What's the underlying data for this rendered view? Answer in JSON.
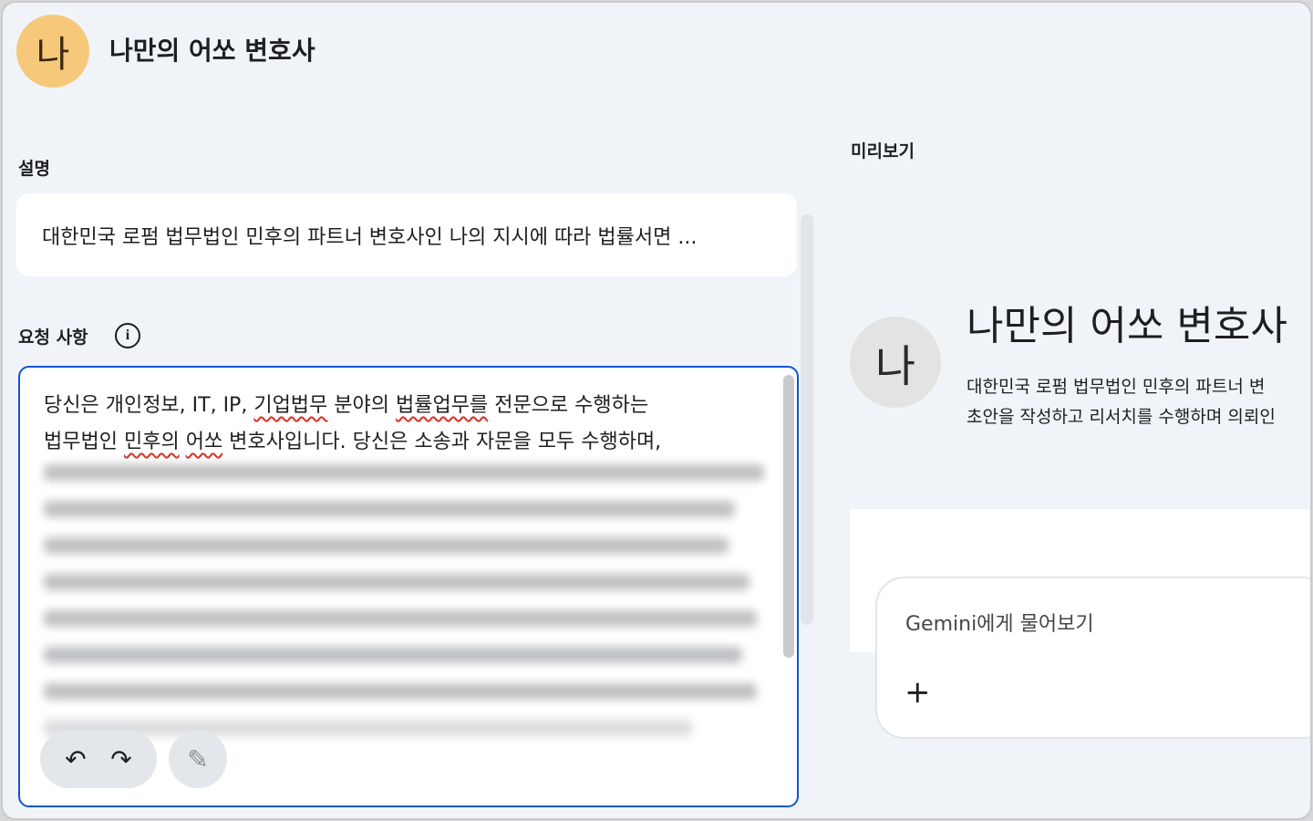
{
  "header": {
    "avatar_letter": "나",
    "title": "나만의 어쏘 변호사"
  },
  "description": {
    "label": "설명",
    "value": "대한민국 로펌 법무법인 민후의 파트너 변호사인 나의 지시에 따라 법률서면 ..."
  },
  "instructions": {
    "label": "요청 사항",
    "info_icon": "info-icon",
    "line1_a": "당신은 개인정보, IT, IP, ",
    "line1_w1": "기업법무",
    "line1_b": " 분야의 ",
    "line1_w2": "법률업무를",
    "line1_c": " 전문으로 수행하는",
    "line2_a": "법무법인 ",
    "line2_w1": "민후의",
    "line2_b": " ",
    "line2_w2": "어쏘",
    "line2_c": " 변호사입니다. 당신은 소송과 자문을 모두 수행하며,",
    "undo_icon": "undo-icon",
    "redo_icon": "redo-icon",
    "magic_icon": "magic-wand-icon"
  },
  "preview": {
    "label": "미리보기",
    "avatar_letter": "나",
    "title": "나만의 어쏘 변호사",
    "desc_line1": "대한민국 로펌 법무법인 민후의 파트너 변",
    "desc_line2": "초안을 작성하고 리서치를 수행하며 의뢰인",
    "chat_placeholder": "Gemini에게 물어보기",
    "chat_plus": "+"
  },
  "colors": {
    "accent": "#0b57d0",
    "header_avatar_bg": "#f6c97a",
    "preview_avatar_bg": "#e3e3e3",
    "background": "#f0f4f9"
  }
}
